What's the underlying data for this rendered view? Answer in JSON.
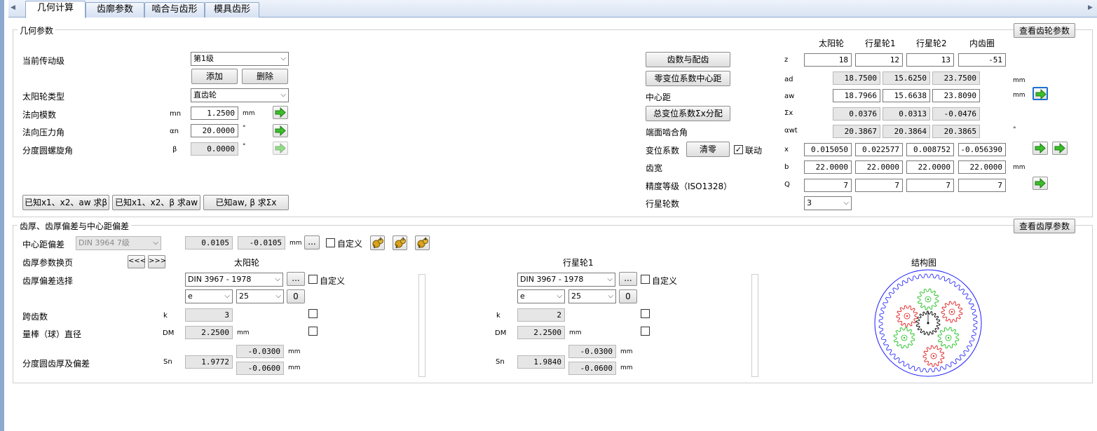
{
  "tabs": [
    {
      "label": "几何计算"
    },
    {
      "label": "齿廓参数"
    },
    {
      "label": "啮合与齿形"
    },
    {
      "label": "模具齿形"
    }
  ],
  "geometry": {
    "title": "几何参数",
    "view_gear_params_btn": "查看齿轮参数",
    "current_stage_label": "当前传动级",
    "current_stage_value": "第1级",
    "add_btn": "添加",
    "delete_btn": "删除",
    "sun_type_label": "太阳轮类型",
    "sun_type_value": "直齿轮",
    "normal_module_label": "法向模数",
    "normal_module_sym": "mn",
    "normal_module_value": "1.2500",
    "normal_module_unit": "mm",
    "pressure_angle_label": "法向压力角",
    "pressure_angle_sym": "αn",
    "pressure_angle_value": "20.0000",
    "pressure_angle_unit": "°",
    "helix_label": "分度圆螺旋角",
    "helix_sym": "β",
    "helix_value": "0.0000",
    "helix_unit": "°",
    "calc_btn1": "已知x1、x2、aw 求β",
    "calc_btn2": "已知x1、x2、β 求aw",
    "calc_btn3": "已知aw, β 求Σx"
  },
  "gear_table": {
    "columns": [
      "太阳轮",
      "行星轮1",
      "行星轮2",
      "内齿圈"
    ],
    "teeth_btn": "齿数与配齿",
    "z_sym": "z",
    "z_values": [
      "18",
      "12",
      "13",
      "-51"
    ],
    "zero_shift_btn": "零变位系数中心距",
    "ad_sym": "ad",
    "ad_values": [
      "18.7500",
      "15.6250",
      "23.7500"
    ],
    "ad_unit": "mm",
    "center_label": "中心距",
    "aw_sym": "aw",
    "aw_values": [
      "18.7966",
      "15.6638",
      "23.8090"
    ],
    "aw_unit": "mm",
    "total_shift_btn": "总变位系数Σx分配",
    "sx_sym": "Σx",
    "sx_values": [
      "0.0376",
      "0.0313",
      "-0.0476"
    ],
    "mesh_angle_label": "端面啮合角",
    "awt_sym": "αwt",
    "awt_values": [
      "20.3867",
      "20.3864",
      "20.3865"
    ],
    "awt_unit": "°",
    "shift_label": "变位系数",
    "clear_btn": "清零",
    "link_label": "联动",
    "link_checked": true,
    "x_sym": "x",
    "x_values": [
      "0.015050",
      "0.022577",
      "0.008752",
      "-0.056390"
    ],
    "width_label": "齿宽",
    "b_sym": "b",
    "b_values": [
      "22.0000",
      "22.0000",
      "22.0000",
      "22.0000"
    ],
    "b_unit": "mm",
    "quality_label": "精度等级（ISO1328）",
    "q_sym": "Q",
    "q_values": [
      "7",
      "7",
      "7",
      "7"
    ],
    "planet_count_label": "行星轮数",
    "planet_count_value": "3"
  },
  "tolerance": {
    "title": "齿厚、齿厚偏差与中心距偏差",
    "view_thickness_btn": "查看齿厚参数",
    "center_dev_label": "中心距偏差",
    "center_dev_std": "DIN 3964 7级",
    "center_dev_upper": "0.0105",
    "center_dev_lower": "-0.0105",
    "center_dev_unit": "mm",
    "ellipsis": "...",
    "custom_label": "自定义",
    "page_label": "齿厚参数换页",
    "prev_btn": "<<<",
    "next_btn": ">>>",
    "structure_label": "结构图",
    "dev_select_label": "齿厚偏差选择",
    "span_label": "跨齿数",
    "ball_label": "量棒（球）直径",
    "thickness_label": "分度圆齿厚及偏差",
    "k_sym": "k",
    "dm_sym": "DM",
    "sn_sym": "Sn",
    "mm": "mm",
    "sun": {
      "title": "太阳轮",
      "std": "DIN 3967  - 1978",
      "field": "e",
      "grade": "25",
      "zero": "0",
      "k": "3",
      "dm": "2.2500",
      "sn": "1.9772",
      "upper": "-0.0300",
      "lower": "-0.0600"
    },
    "planet": {
      "title": "行星轮1",
      "std": "DIN 3967  - 1978",
      "field": "e",
      "grade": "25",
      "zero": "0",
      "k": "2",
      "dm": "2.2500",
      "sn": "1.9840",
      "upper": "-0.0300",
      "lower": "-0.0600"
    }
  },
  "icons": {
    "go_arrow": "right-arrow-icon",
    "gear_pair_icons": [
      "gear-12-icon",
      "gear-23-icon",
      "gear-34-icon"
    ]
  },
  "colors": {
    "arrow_green": "#3cbf2a",
    "tab_border": "#8ea9cf",
    "ring": "#1a1aff",
    "sun": "#000000",
    "planet_a": "#e02020",
    "planet_b": "#20c020"
  }
}
